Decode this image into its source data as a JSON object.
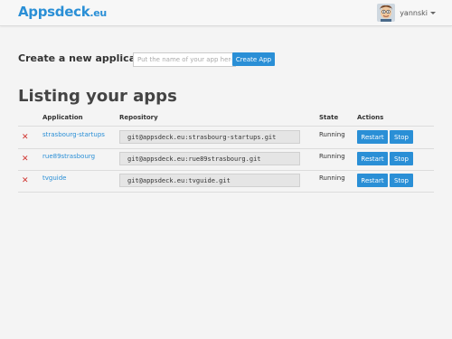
{
  "header": {
    "brand_name": "Appsdeck",
    "brand_tld": ".eu",
    "username": "yannski"
  },
  "create_form": {
    "label": "Create a new application:",
    "input_placeholder": "Put the name of your app here",
    "input_value": "",
    "button_label": "Create App"
  },
  "listing": {
    "title": "Listing your apps",
    "columns": {
      "application": "Application",
      "repository": "Repository",
      "state": "State",
      "actions": "Actions"
    },
    "rows": [
      {
        "delete_glyph": "✕",
        "name": "strasbourg-startups",
        "repository": "git@appsdeck.eu:strasbourg-startups.git",
        "state": "Running",
        "restart_label": "Restart",
        "stop_label": "Stop"
      },
      {
        "delete_glyph": "✕",
        "name": "rue89strasbourg",
        "repository": "git@appsdeck.eu:rue89strasbourg.git",
        "state": "Running",
        "restart_label": "Restart",
        "stop_label": "Stop"
      },
      {
        "delete_glyph": "✕",
        "name": "tvguide",
        "repository": "git@appsdeck.eu:tvguide.git",
        "state": "Running",
        "restart_label": "Restart",
        "stop_label": "Stop"
      }
    ]
  },
  "colors": {
    "brand": "#2a8fd6",
    "button": "#2a8fd6",
    "delete": "#d0312d",
    "background": "#f4f4f4"
  },
  "icons": {
    "avatar": "user-avatar-icon",
    "dropdown": "caret-down-icon",
    "delete": "delete-x-icon"
  }
}
